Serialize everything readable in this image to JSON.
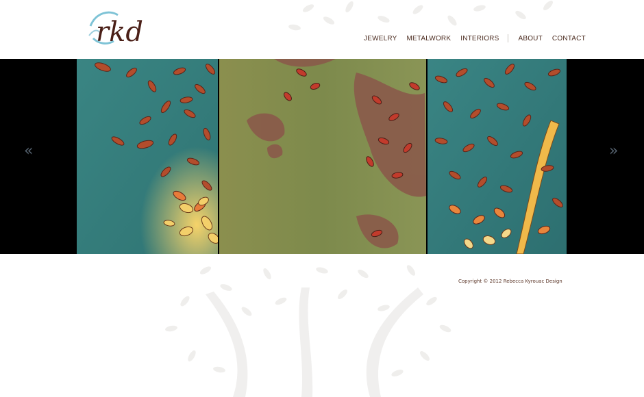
{
  "brand": {
    "logo_text": "rkd"
  },
  "nav": {
    "items": [
      "JEWELRY",
      "METALWORK",
      "INTERIORS",
      "ABOUT",
      "CONTACT"
    ]
  },
  "slider": {
    "prev_label": "«",
    "next_label": "»"
  },
  "footer": {
    "copyright": "Copyright © 2012 Rebecca Kyrouac Design"
  },
  "colors": {
    "nav_text": "#4a2a1e",
    "slider_bg": "#000000",
    "arrow": "#54616e",
    "teal": "#3f8e8c",
    "olive": "#7f8a4c",
    "copper": "#b8553a"
  }
}
